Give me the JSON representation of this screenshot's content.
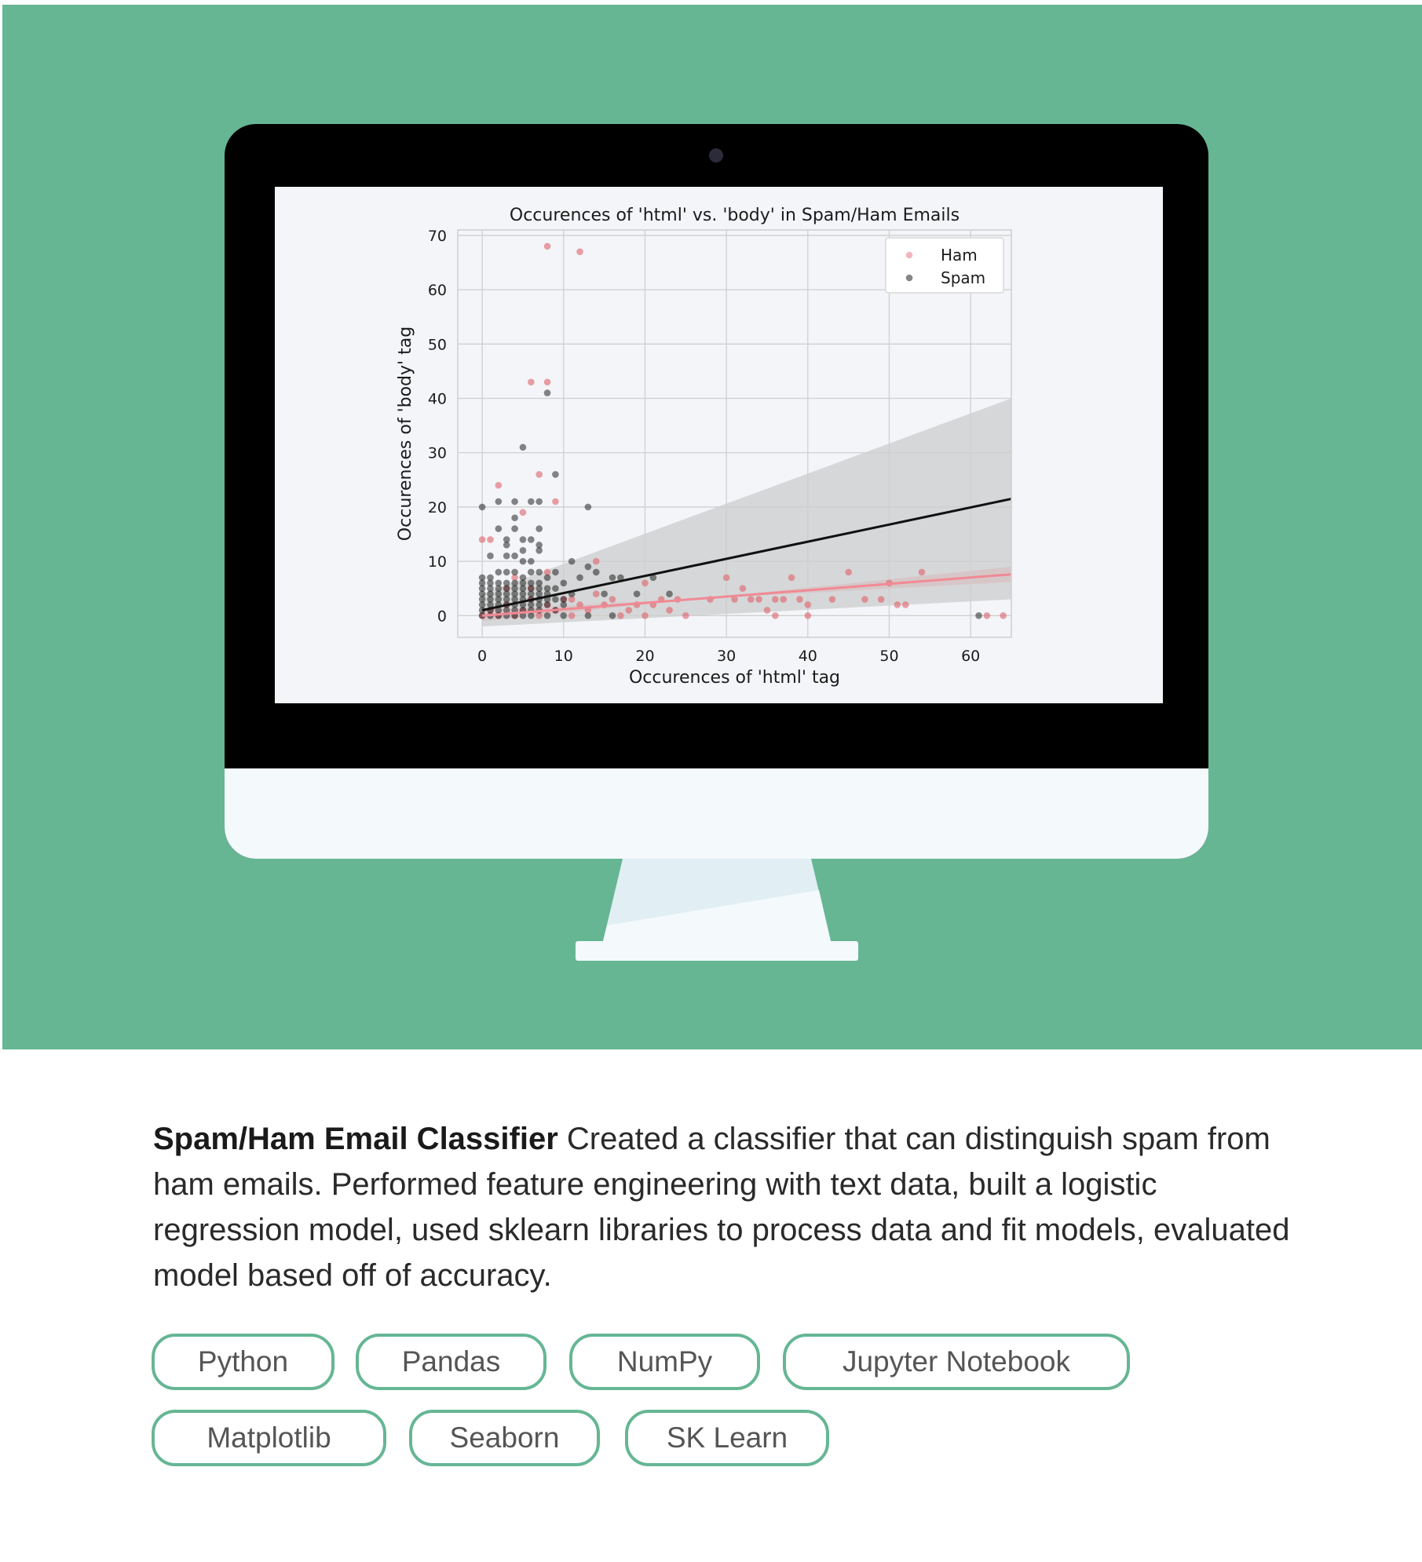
{
  "project": {
    "title": "Spam/Ham Email Classifier",
    "description": "Created a classifier that can distinguish spam from ham emails. Performed feature engineering with text data, built a logistic regression model, used sklearn libraries to process data and fit models, evaluated model based off of accuracy.",
    "tags": [
      "Python",
      "Pandas",
      "NumPy",
      "Jupyter Notebook",
      "Matplotlib",
      "Seaborn",
      "SK Learn"
    ]
  },
  "colors": {
    "hero_background": "#66b694",
    "tag_border": "#66b694",
    "ham": "#e0606a",
    "spam": "#222222"
  },
  "chart_data": {
    "type": "scatter",
    "title": "Occurences of 'html' vs. 'body' in Spam/Ham Emails",
    "xlabel": "Occurences of 'html' tag",
    "ylabel": "Occurences of 'body' tag",
    "xlim": [
      -3,
      65
    ],
    "ylim": [
      -4,
      71
    ],
    "xticks": [
      0,
      10,
      20,
      30,
      40,
      50,
      60
    ],
    "yticks": [
      0,
      10,
      20,
      30,
      40,
      50,
      60,
      70
    ],
    "grid": true,
    "legend_position": "top-right",
    "series": [
      {
        "name": "Ham",
        "points": [
          [
            8,
            68
          ],
          [
            12,
            67
          ],
          [
            6,
            43
          ],
          [
            8,
            43
          ],
          [
            7,
            26
          ],
          [
            9,
            21
          ],
          [
            2,
            24
          ],
          [
            0,
            14
          ],
          [
            1,
            14
          ],
          [
            5,
            19
          ],
          [
            14,
            10
          ],
          [
            30,
            7
          ],
          [
            38,
            7
          ],
          [
            45,
            8
          ],
          [
            50,
            6
          ],
          [
            54,
            8
          ],
          [
            20,
            6
          ],
          [
            22,
            3
          ],
          [
            24,
            3
          ],
          [
            32,
            5
          ],
          [
            33,
            3
          ],
          [
            34,
            3
          ],
          [
            36,
            3
          ],
          [
            37,
            3
          ],
          [
            39,
            3
          ],
          [
            40,
            2
          ],
          [
            43,
            3
          ],
          [
            47,
            3
          ],
          [
            49,
            3
          ],
          [
            51,
            2
          ],
          [
            52,
            2
          ],
          [
            28,
            3
          ],
          [
            31,
            3
          ],
          [
            35,
            1
          ],
          [
            36,
            0
          ],
          [
            40,
            0
          ],
          [
            0,
            0
          ],
          [
            1,
            1
          ],
          [
            2,
            0
          ],
          [
            3,
            2
          ],
          [
            4,
            0
          ],
          [
            5,
            1
          ],
          [
            6,
            3
          ],
          [
            7,
            0
          ],
          [
            8,
            2
          ],
          [
            9,
            1
          ],
          [
            10,
            3
          ],
          [
            11,
            0
          ],
          [
            12,
            2
          ],
          [
            13,
            1
          ],
          [
            15,
            2
          ],
          [
            16,
            3
          ],
          [
            17,
            0
          ],
          [
            18,
            1
          ],
          [
            19,
            2
          ],
          [
            20,
            0
          ],
          [
            21,
            2
          ],
          [
            23,
            1
          ],
          [
            25,
            0
          ],
          [
            64,
            0
          ],
          [
            62,
            0
          ],
          [
            6,
            5
          ],
          [
            4,
            7
          ],
          [
            3,
            5
          ],
          [
            8,
            8
          ],
          [
            11,
            3
          ],
          [
            14,
            4
          ]
        ]
      },
      {
        "name": "Spam",
        "points": [
          [
            8,
            41
          ],
          [
            5,
            31
          ],
          [
            9,
            26
          ],
          [
            13,
            20
          ],
          [
            0,
            20
          ],
          [
            2,
            21
          ],
          [
            4,
            21
          ],
          [
            6,
            21
          ],
          [
            7,
            21
          ],
          [
            4,
            18
          ],
          [
            2,
            16
          ],
          [
            4,
            16
          ],
          [
            7,
            16
          ],
          [
            3,
            14
          ],
          [
            5,
            14
          ],
          [
            6,
            14
          ],
          [
            7,
            13
          ],
          [
            3,
            13
          ],
          [
            5,
            12
          ],
          [
            7,
            12
          ],
          [
            1,
            11
          ],
          [
            3,
            11
          ],
          [
            4,
            11
          ],
          [
            5,
            10
          ],
          [
            6,
            10
          ],
          [
            11,
            10
          ],
          [
            13,
            9
          ],
          [
            14,
            8
          ],
          [
            16,
            7
          ],
          [
            17,
            7
          ],
          [
            21,
            7
          ],
          [
            0,
            7
          ],
          [
            1,
            7
          ],
          [
            2,
            8
          ],
          [
            3,
            8
          ],
          [
            4,
            8
          ],
          [
            5,
            7
          ],
          [
            6,
            8
          ],
          [
            7,
            8
          ],
          [
            8,
            7
          ],
          [
            9,
            8
          ],
          [
            10,
            6
          ],
          [
            12,
            7
          ],
          [
            0,
            6
          ],
          [
            1,
            6
          ],
          [
            2,
            6
          ],
          [
            3,
            6
          ],
          [
            4,
            6
          ],
          [
            5,
            6
          ],
          [
            6,
            6
          ],
          [
            7,
            6
          ],
          [
            0,
            5
          ],
          [
            1,
            5
          ],
          [
            2,
            5
          ],
          [
            3,
            5
          ],
          [
            4,
            5
          ],
          [
            5,
            5
          ],
          [
            6,
            5
          ],
          [
            7,
            5
          ],
          [
            8,
            5
          ],
          [
            9,
            5
          ],
          [
            0,
            4
          ],
          [
            1,
            4
          ],
          [
            2,
            4
          ],
          [
            3,
            4
          ],
          [
            4,
            4
          ],
          [
            5,
            4
          ],
          [
            6,
            4
          ],
          [
            7,
            4
          ],
          [
            8,
            4
          ],
          [
            11,
            4
          ],
          [
            15,
            4
          ],
          [
            19,
            4
          ],
          [
            23,
            4
          ],
          [
            0,
            3
          ],
          [
            1,
            3
          ],
          [
            2,
            3
          ],
          [
            3,
            3
          ],
          [
            4,
            3
          ],
          [
            5,
            3
          ],
          [
            6,
            3
          ],
          [
            7,
            3
          ],
          [
            8,
            3
          ],
          [
            9,
            3
          ],
          [
            10,
            3
          ],
          [
            0,
            2
          ],
          [
            1,
            2
          ],
          [
            2,
            2
          ],
          [
            3,
            2
          ],
          [
            4,
            2
          ],
          [
            5,
            2
          ],
          [
            6,
            2
          ],
          [
            7,
            2
          ],
          [
            8,
            2
          ],
          [
            10,
            2
          ],
          [
            0,
            1
          ],
          [
            1,
            1
          ],
          [
            2,
            1
          ],
          [
            3,
            1
          ],
          [
            4,
            1
          ],
          [
            5,
            1
          ],
          [
            6,
            1
          ],
          [
            7,
            1
          ],
          [
            9,
            1
          ],
          [
            0,
            0
          ],
          [
            1,
            0
          ],
          [
            2,
            0
          ],
          [
            3,
            0
          ],
          [
            4,
            0
          ],
          [
            5,
            0
          ],
          [
            6,
            0
          ],
          [
            8,
            0
          ],
          [
            10,
            0
          ],
          [
            13,
            0
          ],
          [
            16,
            0
          ],
          [
            61,
            0
          ]
        ]
      }
    ],
    "regression": [
      {
        "series": "Ham",
        "line": [
          [
            0,
            0
          ],
          [
            65,
            7.6
          ]
        ],
        "ci_band": [
          [
            0,
            1
          ],
          [
            65,
            9
          ]
        ]
      },
      {
        "series": "Spam",
        "line": [
          [
            0,
            1
          ],
          [
            65,
            21.5
          ]
        ],
        "ci_band": [
          [
            0,
            -2
          ],
          [
            65,
            40
          ]
        ]
      }
    ]
  }
}
